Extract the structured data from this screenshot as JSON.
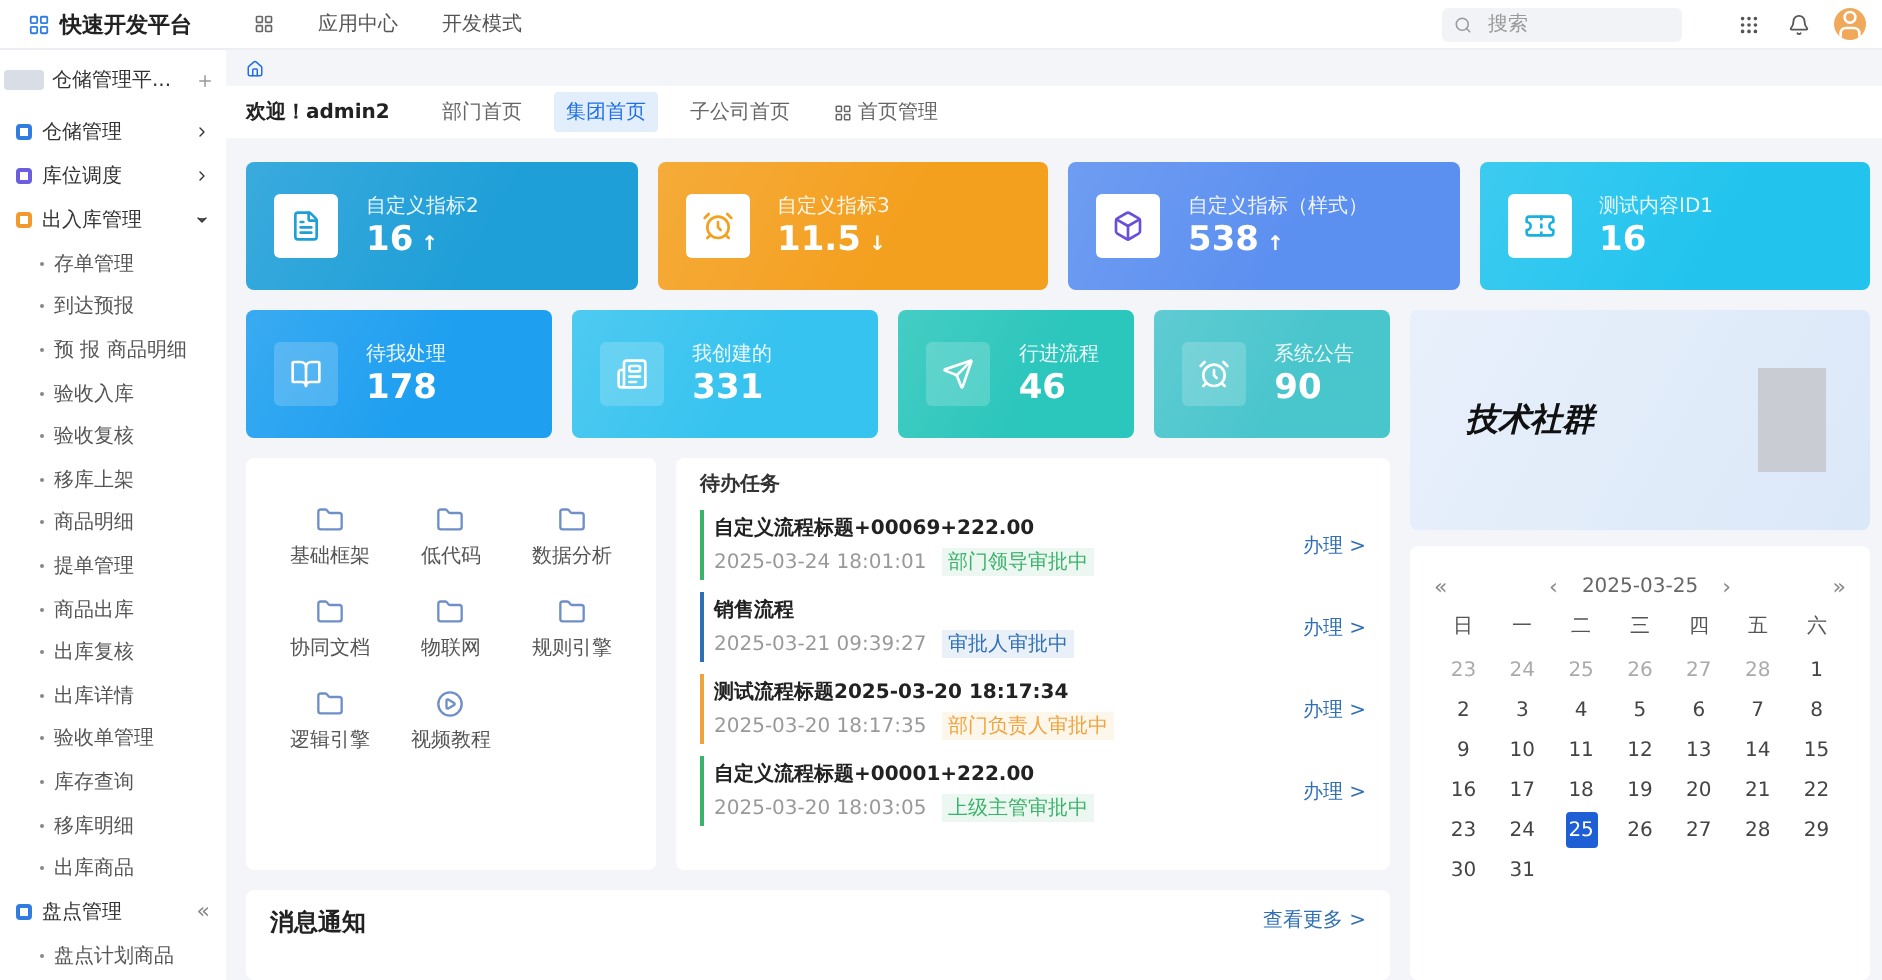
{
  "header": {
    "logo": "快速开发平台",
    "nav": [
      {
        "label": "应用中心",
        "selected": false
      },
      {
        "label": "开发模式",
        "selected": false
      }
    ],
    "search": {
      "placeholder": "搜索"
    }
  },
  "sidebar": {
    "org": "仓储管理平...",
    "collapse": "«",
    "items": [
      {
        "label": "仓储管理",
        "color": "#2f7de1",
        "expanded": false
      },
      {
        "label": "库位调度",
        "color": "#6a5de0",
        "expanded": false
      },
      {
        "label": "出入库管理",
        "color": "#f29a2e",
        "expanded": true,
        "children": [
          {
            "label": "存单管理"
          },
          {
            "label": "到达预报"
          },
          {
            "label": "预 报 商品明细"
          },
          {
            "label": "验收入库"
          },
          {
            "label": "验收复核"
          },
          {
            "label": "移库上架"
          },
          {
            "label": "商品明细"
          },
          {
            "label": "提单管理"
          },
          {
            "label": "商品出库"
          },
          {
            "label": "出库复核"
          },
          {
            "label": "出库详情"
          },
          {
            "label": "验收单管理"
          },
          {
            "label": "库存查询"
          },
          {
            "label": "移库明细"
          },
          {
            "label": "出库商品"
          }
        ]
      },
      {
        "label": "盘点管理",
        "color": "#2f7de1",
        "expanded": true,
        "children": [
          {
            "label": "盘点计划商品"
          }
        ]
      }
    ]
  },
  "welcome": "欢迎！admin2",
  "tabs": [
    {
      "label": "部门首页",
      "selected": false
    },
    {
      "label": "集团首页",
      "selected": true
    },
    {
      "label": "子公司首页",
      "selected": false
    },
    {
      "label": "首页管理",
      "selected": false
    }
  ],
  "stats_top": [
    {
      "title": "自定义指标2",
      "value": "16",
      "trend": "↑",
      "color": "#1f9fd8"
    },
    {
      "title": "自定义指标3",
      "value": "11.5",
      "trend": "↓",
      "color": "#f4a01f"
    },
    {
      "title": "自定义指标（样式）",
      "value": "538",
      "trend": "↑",
      "color": "#5b8ff0"
    },
    {
      "title": "测试内容ID1",
      "value": "16",
      "color": "#22c4ee"
    }
  ],
  "stats_bottom": [
    {
      "title": "待我处理",
      "value": "178",
      "color": "#1e9ff0"
    },
    {
      "title": "我创建的",
      "value": "331",
      "color": "#36c3ef"
    },
    {
      "title": "行进流程",
      "value": "46",
      "color": "#2bc6bc"
    },
    {
      "title": "系统公告",
      "value": "90",
      "color": "#49c5cc"
    }
  ],
  "banner": {
    "title": "技术社群"
  },
  "apps": [
    {
      "label": "基础框架"
    },
    {
      "label": "低代码"
    },
    {
      "label": "数据分析"
    },
    {
      "label": "协同文档"
    },
    {
      "label": "物联网"
    },
    {
      "label": "规则引擎"
    },
    {
      "label": "逻辑引擎"
    },
    {
      "label": "视频教程"
    }
  ],
  "todo": {
    "title": "待办任务",
    "items": [
      {
        "title": "自定义流程标题+00069+222.00",
        "time": "2025-03-24 18:01:01",
        "status": "部门领导审批中",
        "color": "#3bb36b",
        "action": "办理 >"
      },
      {
        "title": "销售流程",
        "time": "2025-03-21 09:39:27",
        "status": "审批人审批中",
        "color": "#2f6fb5",
        "action": "办理 >"
      },
      {
        "title": "测试流程标题2025-03-20 18:17:34",
        "time": "2025-03-20 18:17:35",
        "status": "部门负责人审批中",
        "color": "#f0a33c",
        "action": "办理 >"
      },
      {
        "title": "自定义流程标题+00001+222.00",
        "time": "2025-03-20 18:03:05",
        "status": "上级主管审批中",
        "color": "#3bb36b",
        "action": "办理 >"
      }
    ]
  },
  "messages": {
    "title": "消息通知",
    "more": "查看更多 >"
  },
  "calendar": {
    "prev_year": "«",
    "prev_month": "‹",
    "month": "2025-03-25",
    "next_month": "›",
    "next_year": "»",
    "weekdays": [
      "日",
      "一",
      "二",
      "三",
      "四",
      "五",
      "六"
    ],
    "days": [
      {
        "label": "23",
        "muted": true,
        "selected": false
      },
      {
        "label": "24",
        "muted": true,
        "selected": false
      },
      {
        "label": "25",
        "muted": true,
        "selected": false
      },
      {
        "label": "26",
        "muted": true,
        "selected": false
      },
      {
        "label": "27",
        "muted": true,
        "selected": false
      },
      {
        "label": "28",
        "muted": true,
        "selected": false
      },
      {
        "label": "1",
        "muted": false,
        "selected": false
      },
      {
        "label": "2",
        "muted": false,
        "selected": false
      },
      {
        "label": "3",
        "muted": false,
        "selected": false
      },
      {
        "label": "4",
        "muted": false,
        "selected": false
      },
      {
        "label": "5",
        "muted": false,
        "selected": false
      },
      {
        "label": "6",
        "muted": false,
        "selected": false
      },
      {
        "label": "7",
        "muted": false,
        "selected": false
      },
      {
        "label": "8",
        "muted": false,
        "selected": false
      },
      {
        "label": "9",
        "muted": false,
        "selected": false
      },
      {
        "label": "10",
        "muted": false,
        "selected": false
      },
      {
        "label": "11",
        "muted": false,
        "selected": false
      },
      {
        "label": "12",
        "muted": false,
        "selected": false
      },
      {
        "label": "13",
        "muted": false,
        "selected": false
      },
      {
        "label": "14",
        "muted": false,
        "selected": false
      },
      {
        "label": "15",
        "muted": false,
        "selected": false
      },
      {
        "label": "16",
        "muted": false,
        "selected": false
      },
      {
        "label": "17",
        "muted": false,
        "selected": false
      },
      {
        "label": "18",
        "muted": false,
        "selected": false
      },
      {
        "label": "19",
        "muted": false,
        "selected": false
      },
      {
        "label": "20",
        "muted": false,
        "selected": false
      },
      {
        "label": "21",
        "muted": false,
        "selected": false
      },
      {
        "label": "22",
        "muted": false,
        "selected": false
      },
      {
        "label": "23",
        "muted": false,
        "selected": false
      },
      {
        "label": "24",
        "muted": false,
        "selected": false
      },
      {
        "label": "25",
        "muted": false,
        "selected": true
      },
      {
        "label": "26",
        "muted": false,
        "selected": false
      },
      {
        "label": "27",
        "muted": false,
        "selected": false
      },
      {
        "label": "28",
        "muted": false,
        "selected": false
      },
      {
        "label": "29",
        "muted": false,
        "selected": false
      },
      {
        "label": "30",
        "muted": false,
        "selected": false
      },
      {
        "label": "31",
        "muted": false,
        "selected": false
      }
    ]
  }
}
